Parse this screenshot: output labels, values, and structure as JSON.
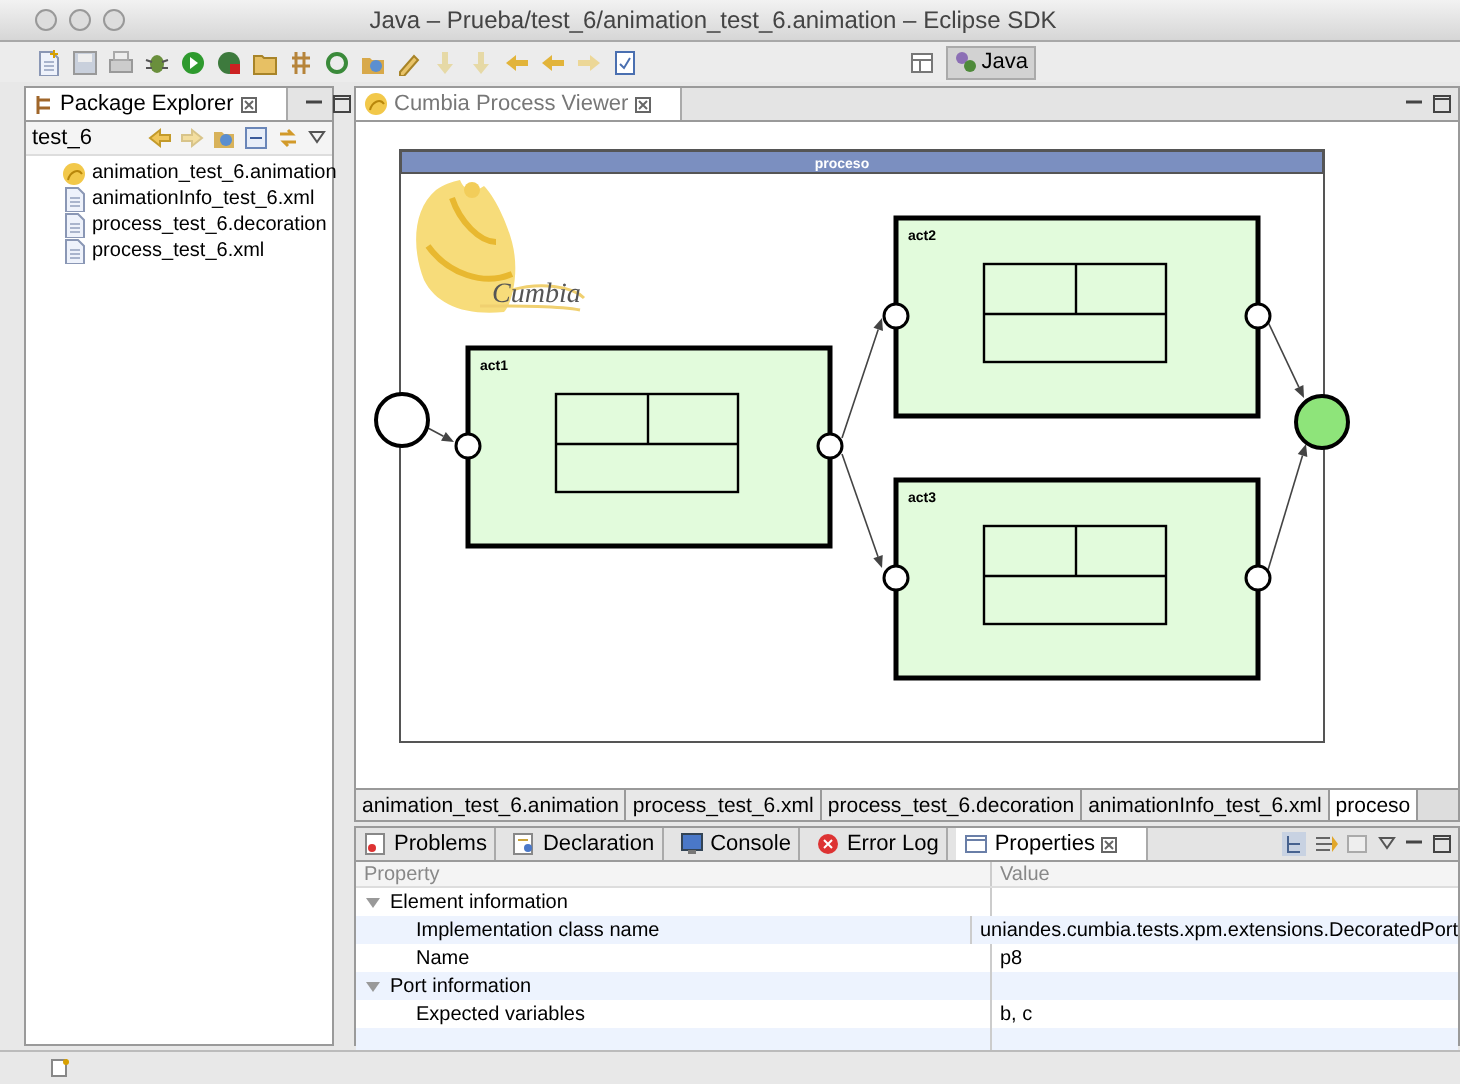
{
  "window": {
    "title": "Java – Prueba/test_6/animation_test_6.animation – Eclipse SDK"
  },
  "perspective": {
    "label": "Java",
    "selected": true
  },
  "package_explorer": {
    "title": "Package Explorer",
    "project": "test_6",
    "files": [
      {
        "name": "animation_test_6.animation",
        "kind": "animation"
      },
      {
        "name": "animationInfo_test_6.xml",
        "kind": "file"
      },
      {
        "name": "process_test_6.decoration",
        "kind": "file"
      },
      {
        "name": "process_test_6.xml",
        "kind": "file"
      }
    ]
  },
  "editor": {
    "title": "Cumbia Process Viewer",
    "diagram": {
      "title": "proceso",
      "logo_text": "Cumbia",
      "events": [
        {
          "kind": "start"
        },
        {
          "kind": "end"
        }
      ],
      "activities": [
        {
          "label": "act1"
        },
        {
          "label": "act2"
        },
        {
          "label": "act3"
        }
      ]
    },
    "tabs": [
      {
        "label": "animation_test_6.animation",
        "selected": false
      },
      {
        "label": "process_test_6.xml",
        "selected": false
      },
      {
        "label": "process_test_6.decoration",
        "selected": false
      },
      {
        "label": "animationInfo_test_6.xml",
        "selected": false
      },
      {
        "label": "proceso",
        "selected": true
      }
    ]
  },
  "views": {
    "tabs": [
      {
        "label": "Problems",
        "selected": false
      },
      {
        "label": "Declaration",
        "selected": false
      },
      {
        "label": "Console",
        "selected": false
      },
      {
        "label": "Error Log",
        "selected": false
      },
      {
        "label": "Properties",
        "selected": true
      }
    ],
    "properties": {
      "columns": [
        "Property",
        "Value"
      ],
      "rows": [
        {
          "label": "Element information",
          "expanded": true,
          "children": [
            {
              "label": "Implementation class name",
              "value": "uniandes.cumbia.tests.xpm.extensions.DecoratedPort"
            },
            {
              "label": "Name",
              "value": "p8"
            }
          ]
        },
        {
          "label": "Port information",
          "expanded": true,
          "children": [
            {
              "label": "Expected variables",
              "value": "b, c"
            }
          ]
        }
      ]
    }
  }
}
